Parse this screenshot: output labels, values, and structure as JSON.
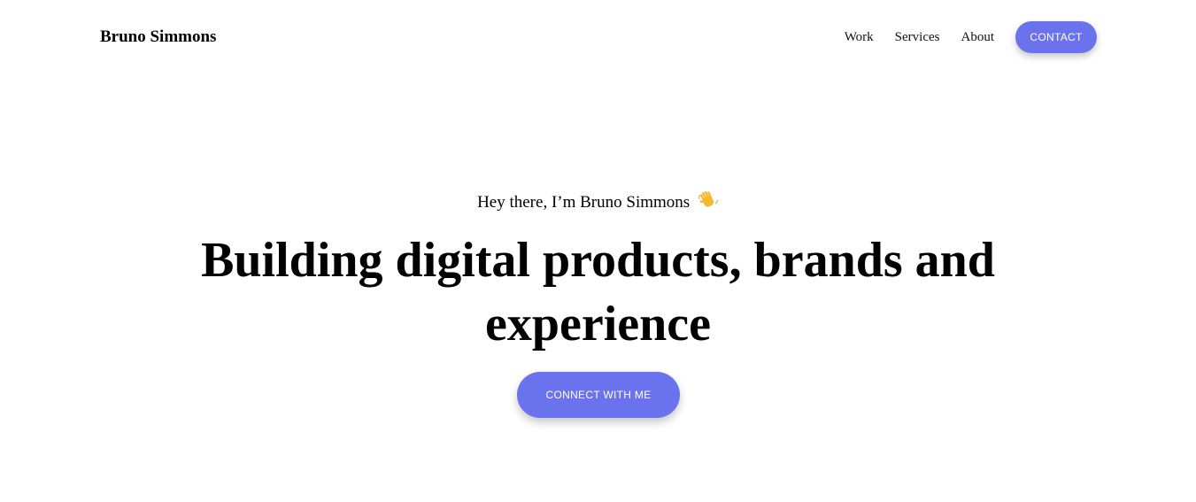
{
  "header": {
    "brand": "Bruno Simmons",
    "nav": [
      {
        "label": "Work"
      },
      {
        "label": "Services"
      },
      {
        "label": "About"
      }
    ],
    "contact_label": "CONTACT"
  },
  "hero": {
    "greeting": "Hey there, I’m Bruno Simmons",
    "greeting_icon": "waving-hand-icon",
    "headline": "Building digital products, brands and experience",
    "cta_label": "CONNECT WITH ME"
  },
  "colors": {
    "accent": "#6b72ee",
    "text": "#000000",
    "background": "#ffffff"
  }
}
